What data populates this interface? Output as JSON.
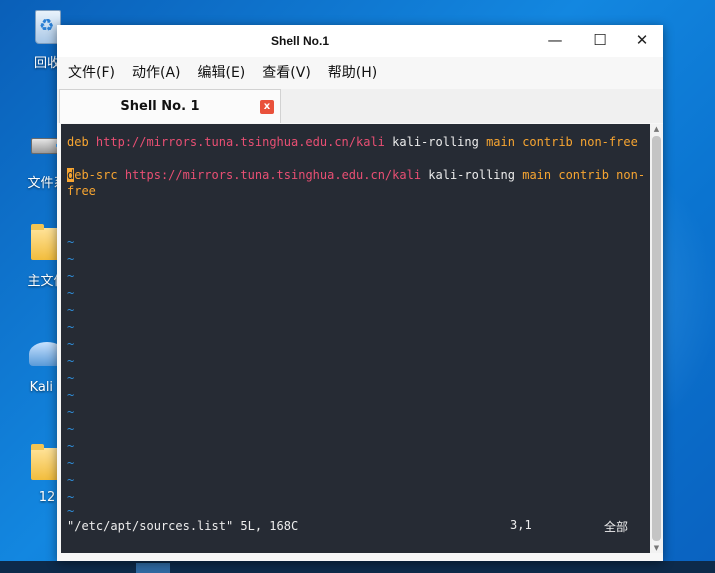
{
  "desktop": {
    "icons": [
      {
        "label": "回收"
      },
      {
        "label": "文件系"
      },
      {
        "label": "主文件"
      },
      {
        "label": "Kali L"
      },
      {
        "label": "12"
      }
    ]
  },
  "window": {
    "title": "Shell No.1",
    "controls": {
      "minimize": "—",
      "maximize": "☐",
      "close": "✕"
    }
  },
  "menu": [
    {
      "label": "文件(F)"
    },
    {
      "label": "动作(A)"
    },
    {
      "label": "编辑(E)"
    },
    {
      "label": "查看(V)"
    },
    {
      "label": "帮助(H)"
    }
  ],
  "tab": {
    "label": "Shell No. 1",
    "close": "x"
  },
  "editor": {
    "line1": {
      "kw": "deb",
      "url": "http://mirrors.tuna.tsinghua.edu.cn/kali",
      "suite": "kali-rolling",
      "components": "main contrib non-free"
    },
    "line2": {
      "cursor_char": "d",
      "kw_rest": "eb-src",
      "url": "https://mirrors.tuna.tsinghua.edu.cn/kali",
      "suite": "kali-rolling",
      "components": "main contrib non-",
      "wrap": "free"
    },
    "empty_marker": "~",
    "status": {
      "file": "\"/etc/apt/sources.list\" 5L, 168C",
      "position": "3,1",
      "scope": "全部"
    }
  }
}
